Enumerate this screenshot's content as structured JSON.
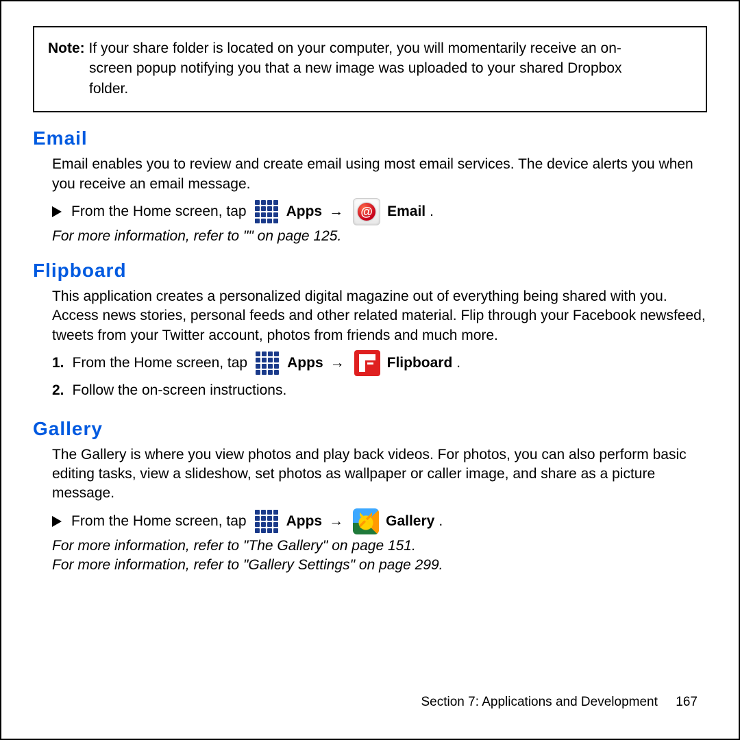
{
  "note": {
    "label": "Note:",
    "line1_rest": " If your share folder is located on your computer, you will momentarily receive an on-",
    "line2": "screen popup notifying you that a new image was uploaded to your shared Dropbox",
    "line3": "folder."
  },
  "email": {
    "heading": "Email",
    "desc": "Email enables you to review and create email using most email services. The device alerts you when you receive an email message.",
    "step_pre": "From the Home screen, tap",
    "apps_label": "Apps",
    "arrow": "→",
    "target": "Email",
    "period": ".",
    "ref": "For more information, refer to \"\" on page 125."
  },
  "flipboard": {
    "heading": "Flipboard",
    "desc": "This application creates a personalized digital magazine out of everything being shared with you. Access news stories, personal feeds and other related material. Flip through your Facebook newsfeed, tweets from your Twitter account, photos from friends and much more.",
    "step1_num": "1.",
    "step1_pre": "From the Home screen, tap",
    "apps_label": "Apps",
    "arrow": "→",
    "target": "Flipboard",
    "period": ".",
    "step2_num": "2.",
    "step2_text": "Follow the on-screen instructions."
  },
  "gallery": {
    "heading": "Gallery",
    "desc": "The Gallery is where you view photos and play back videos. For photos, you can also perform basic editing tasks, view a slideshow, set photos as wallpaper or caller image, and share as a picture message.",
    "step_pre": "From the Home screen, tap",
    "apps_label": "Apps",
    "arrow": "→",
    "target": "Gallery",
    "period": ".",
    "ref1": "For more information, refer to \"The Gallery\" on page 151.",
    "ref2": "For more information, refer to \"Gallery Settings\" on page 299."
  },
  "footer": {
    "section": "Section 7:  Applications and Development",
    "page": "167"
  }
}
